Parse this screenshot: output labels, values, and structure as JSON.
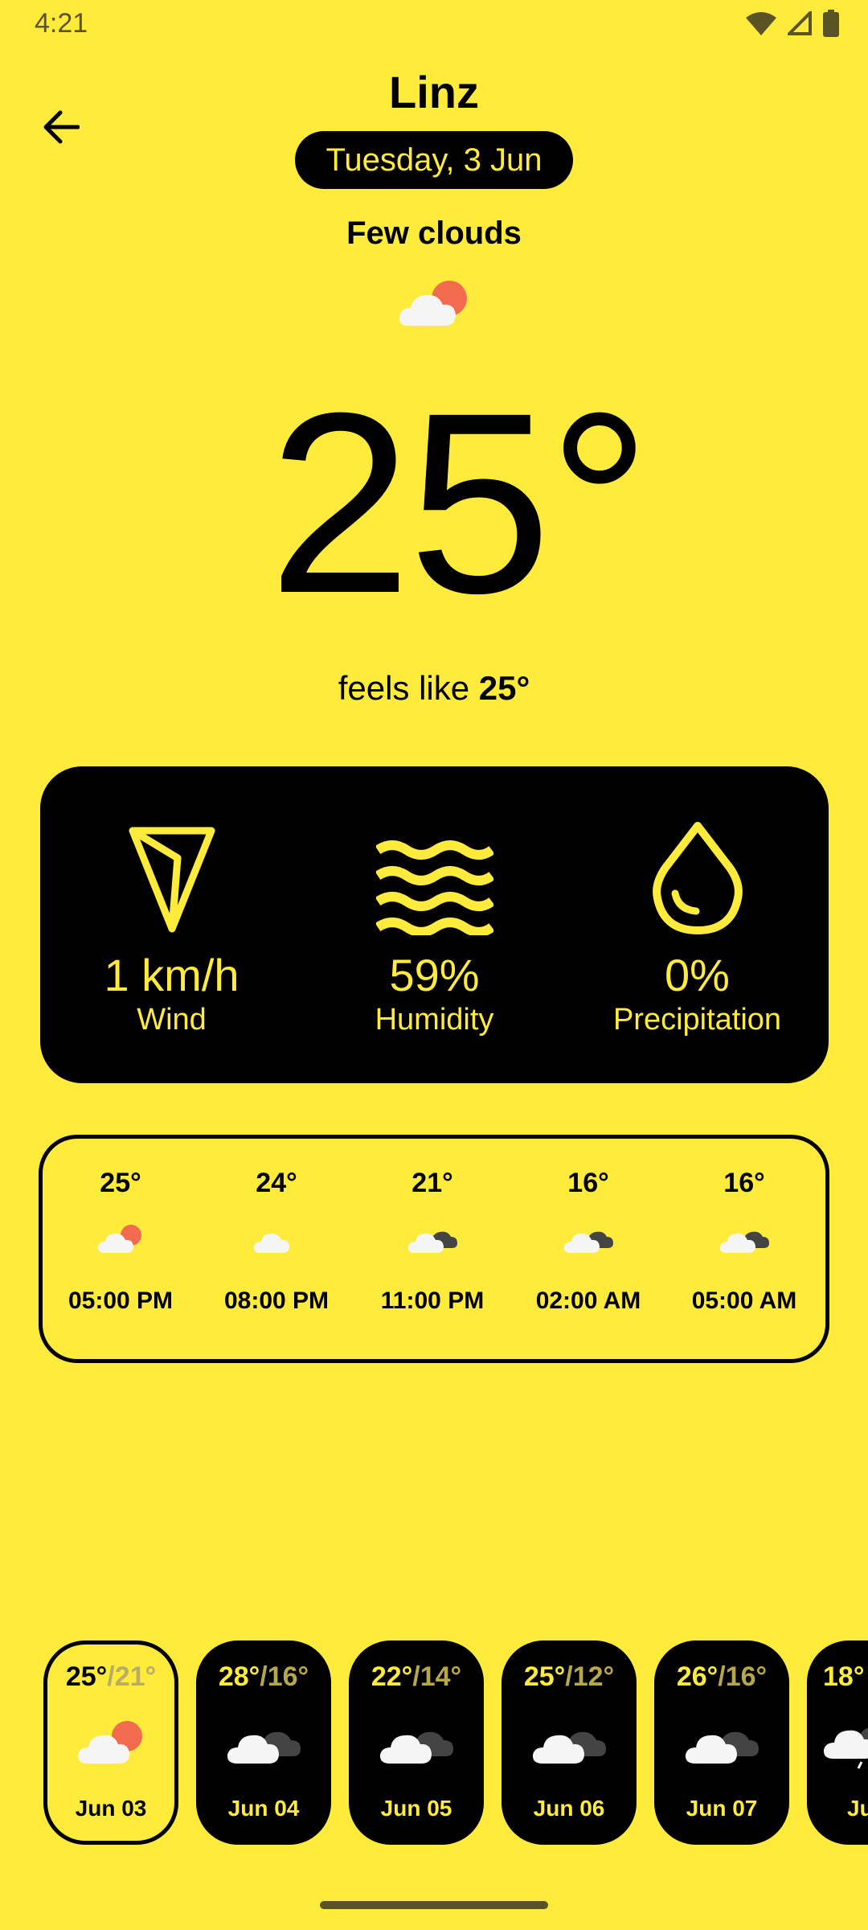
{
  "status_bar": {
    "time": "4:21"
  },
  "header": {
    "city": "Linz",
    "date": "Tuesday, 3 Jun",
    "condition": "Few clouds",
    "condition_icon": "cloud-sun-icon"
  },
  "current": {
    "temperature": "25°",
    "feels_like_label": "feels like",
    "feels_like_value": "25°"
  },
  "metrics": [
    {
      "icon": "wind-direction-icon",
      "value": "1 km/h",
      "label": "Wind"
    },
    {
      "icon": "humidity-waves-icon",
      "value": "59%",
      "label": "Humidity"
    },
    {
      "icon": "water-drop-icon",
      "value": "0%",
      "label": "Precipitation"
    }
  ],
  "hourly": [
    {
      "temp": "25°",
      "time": "05:00 PM",
      "icon": "cloud-sun-icon"
    },
    {
      "temp": "24°",
      "time": "08:00 PM",
      "icon": "cloud-icon"
    },
    {
      "temp": "21°",
      "time": "11:00 PM",
      "icon": "cloud-dark-icon"
    },
    {
      "temp": "16°",
      "time": "02:00 AM",
      "icon": "cloud-dark-icon"
    },
    {
      "temp": "16°",
      "time": "05:00 AM",
      "icon": "cloud-dark-icon"
    }
  ],
  "daily": [
    {
      "high": "25°",
      "low": "/21°",
      "date": "Jun 03",
      "icon": "cloud-sun-icon",
      "selected": true
    },
    {
      "high": "28°",
      "low": "/16°",
      "date": "Jun 04",
      "icon": "cloud-dark-icon"
    },
    {
      "high": "22°",
      "low": "/14°",
      "date": "Jun 05",
      "icon": "cloud-dark-icon"
    },
    {
      "high": "25°",
      "low": "/12°",
      "date": "Jun 06",
      "icon": "cloud-dark-icon"
    },
    {
      "high": "26°",
      "low": "/16°",
      "date": "Jun 07",
      "icon": "cloud-dark-icon"
    },
    {
      "high": "18°",
      "low": "",
      "date": "Jun",
      "icon": "cloud-rain-icon"
    }
  ],
  "colors": {
    "accent": "#FFEB3B",
    "dark": "#000000",
    "sun": "#F26B4E"
  }
}
